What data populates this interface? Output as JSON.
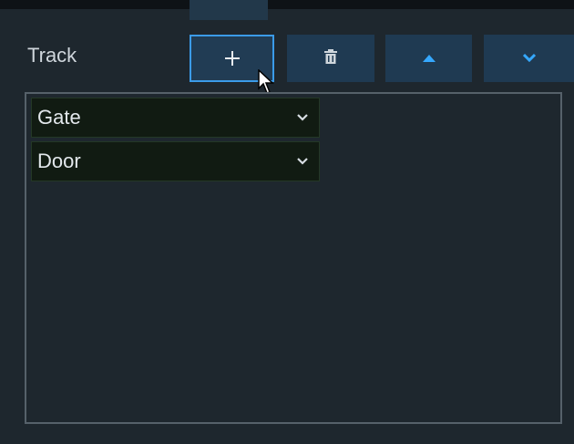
{
  "track": {
    "label": "Track"
  },
  "toolbar": {
    "add_icon": "plus-icon",
    "delete_icon": "trash-icon",
    "up_icon": "triangle-up-icon",
    "down_icon": "chevron-down-icon"
  },
  "tracks": [
    {
      "value": "Gate"
    },
    {
      "value": "Door"
    }
  ],
  "colors": {
    "background": "#1e272e",
    "button": "#1f3a52",
    "button_focus_border": "#3b9be8",
    "accent_icon": "#35a8ff",
    "dropdown_bg": "#111b12"
  }
}
